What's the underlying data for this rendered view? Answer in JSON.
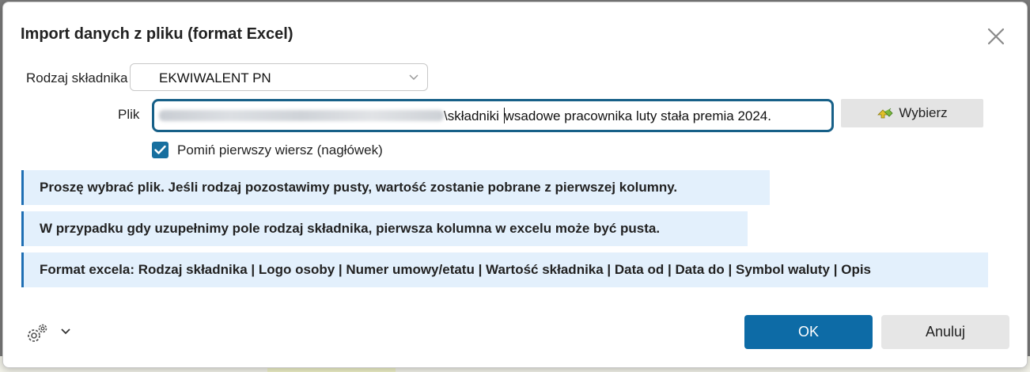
{
  "dialog": {
    "title": "Import danych z pliku (format Excel)"
  },
  "form": {
    "type_label": "Rodzaj składnika",
    "type_value": "EKWIWALENT PN",
    "file_label": "Plik",
    "file_path_visible": "\\składniki ",
    "file_path_rest": "wsadowe pracownika luty stała premia 2024.",
    "select_button_label": "Wybierz",
    "skip_header_label": "Pomiń pierwszy wiersz (nagłówek)",
    "skip_header_checked": true
  },
  "info": [
    "Proszę wybrać plik. Jeśli rodzaj pozostawimy pusty, wartość zostanie pobrane z pierwszej kolumny.",
    "W przypadku gdy uzupełnimy pole rodzaj składnika, pierwsza kolumna w excelu może być pusta.",
    "Format excela: Rodzaj składnika | Logo osoby | Numer umowy/etatu | Wartość składnika | Data od | Data do | Symbol waluty | Opis"
  ],
  "footer": {
    "ok_label": "OK",
    "cancel_label": "Anuluj",
    "settings_icon": "gear-icon"
  },
  "colors": {
    "accent": "#0d6ba6",
    "info_bg": "#e3f0fc",
    "info_border": "#1f6fb4",
    "input_focus_border": "#176088"
  }
}
